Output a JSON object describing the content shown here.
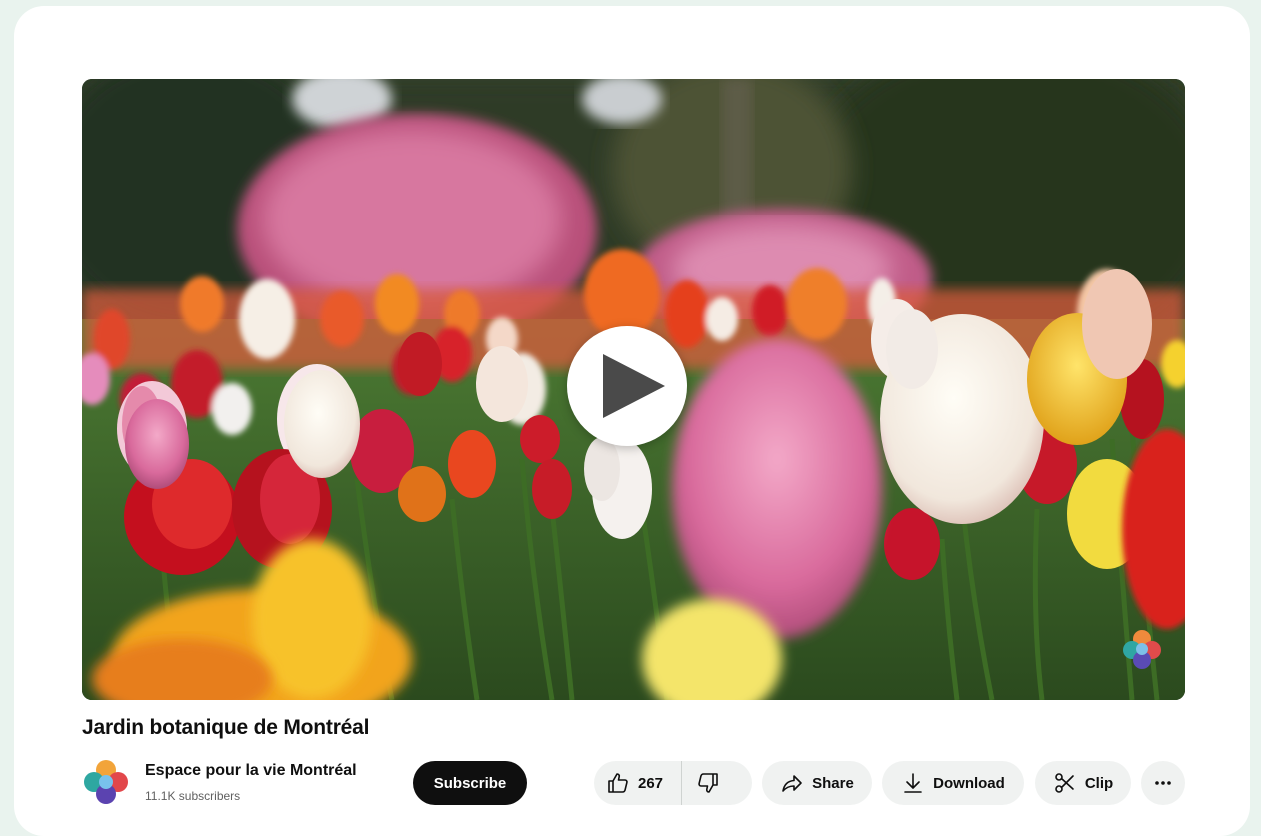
{
  "video": {
    "title": "Jardin botanique de Montréal",
    "play_icon": "play-icon"
  },
  "channel": {
    "name": "Espace pour la vie Montréal",
    "subscribers": "11.1K subscribers",
    "avatar_icon": "channel-logo"
  },
  "actions": {
    "subscribe_label": "Subscribe",
    "like_count": "267",
    "share_label": "Share",
    "download_label": "Download",
    "clip_label": "Clip",
    "more_icon": "more-horizontal-icon"
  },
  "colors": {
    "background": "#e9f3ee",
    "subscribe": "#0f0f0f",
    "pill": "#f0f2f1"
  }
}
